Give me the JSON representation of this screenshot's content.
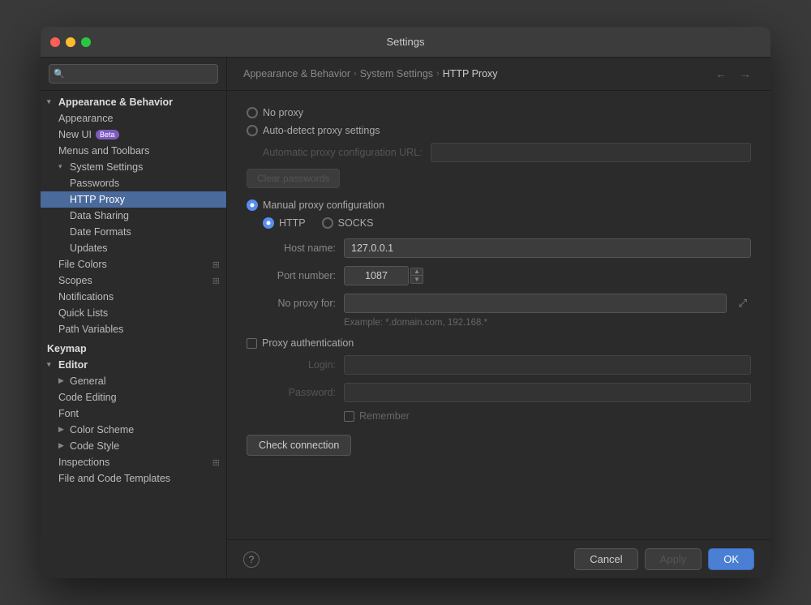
{
  "window": {
    "title": "Settings"
  },
  "breadcrumb": {
    "part1": "Appearance & Behavior",
    "part2": "System Settings",
    "part3": "HTTP Proxy"
  },
  "sidebar": {
    "search_placeholder": "🔍",
    "items": [
      {
        "id": "appearance-behavior",
        "label": "Appearance & Behavior",
        "level": 0,
        "type": "group",
        "expanded": true
      },
      {
        "id": "appearance",
        "label": "Appearance",
        "level": 1,
        "type": "leaf"
      },
      {
        "id": "new-ui",
        "label": "New UI",
        "level": 1,
        "type": "leaf",
        "badge": "Beta"
      },
      {
        "id": "menus-toolbars",
        "label": "Menus and Toolbars",
        "level": 1,
        "type": "leaf"
      },
      {
        "id": "system-settings",
        "label": "System Settings",
        "level": 1,
        "type": "group",
        "expanded": true
      },
      {
        "id": "passwords",
        "label": "Passwords",
        "level": 2,
        "type": "leaf"
      },
      {
        "id": "http-proxy",
        "label": "HTTP Proxy",
        "level": 2,
        "type": "leaf",
        "selected": true
      },
      {
        "id": "data-sharing",
        "label": "Data Sharing",
        "level": 2,
        "type": "leaf"
      },
      {
        "id": "date-formats",
        "label": "Date Formats",
        "level": 2,
        "type": "leaf"
      },
      {
        "id": "updates",
        "label": "Updates",
        "level": 2,
        "type": "leaf"
      },
      {
        "id": "file-colors",
        "label": "File Colors",
        "level": 1,
        "type": "leaf",
        "icon_right": true
      },
      {
        "id": "scopes",
        "label": "Scopes",
        "level": 1,
        "type": "leaf",
        "icon_right": true
      },
      {
        "id": "notifications",
        "label": "Notifications",
        "level": 1,
        "type": "leaf"
      },
      {
        "id": "quick-lists",
        "label": "Quick Lists",
        "level": 1,
        "type": "leaf"
      },
      {
        "id": "path-variables",
        "label": "Path Variables",
        "level": 1,
        "type": "leaf"
      },
      {
        "id": "keymap",
        "label": "Keymap",
        "level": 0,
        "type": "leaf",
        "bold": true
      },
      {
        "id": "editor",
        "label": "Editor",
        "level": 0,
        "type": "group",
        "expanded": true
      },
      {
        "id": "general",
        "label": "General",
        "level": 1,
        "type": "group",
        "collapsed": true
      },
      {
        "id": "code-editing",
        "label": "Code Editing",
        "level": 1,
        "type": "leaf"
      },
      {
        "id": "font",
        "label": "Font",
        "level": 1,
        "type": "leaf"
      },
      {
        "id": "color-scheme",
        "label": "Color Scheme",
        "level": 1,
        "type": "group",
        "collapsed": true
      },
      {
        "id": "code-style",
        "label": "Code Style",
        "level": 1,
        "type": "group",
        "collapsed": true
      },
      {
        "id": "inspections",
        "label": "Inspections",
        "level": 1,
        "type": "leaf",
        "icon_right": true
      },
      {
        "id": "file-code-templates",
        "label": "File and Code Templates",
        "level": 1,
        "type": "leaf"
      }
    ]
  },
  "proxy_settings": {
    "no_proxy_label": "No proxy",
    "auto_detect_label": "Auto-detect proxy settings",
    "auto_url_label": "Automatic proxy configuration URL:",
    "clear_passwords_label": "Clear passwords",
    "manual_label": "Manual proxy configuration",
    "http_label": "HTTP",
    "socks_label": "SOCKS",
    "host_name_label": "Host name:",
    "host_name_value": "127.0.0.1",
    "port_label": "Port number:",
    "port_value": "1087",
    "no_proxy_for_label": "No proxy for:",
    "no_proxy_for_value": "",
    "example_text": "Example: *.domain.com, 192.168.*",
    "proxy_auth_label": "Proxy authentication",
    "login_label": "Login:",
    "login_value": "",
    "password_label": "Password:",
    "password_value": "",
    "remember_label": "Remember",
    "check_connection_label": "Check connection",
    "selected_radio": "manual",
    "selected_protocol": "http"
  },
  "footer": {
    "help_label": "?",
    "cancel_label": "Cancel",
    "apply_label": "Apply",
    "ok_label": "OK"
  }
}
